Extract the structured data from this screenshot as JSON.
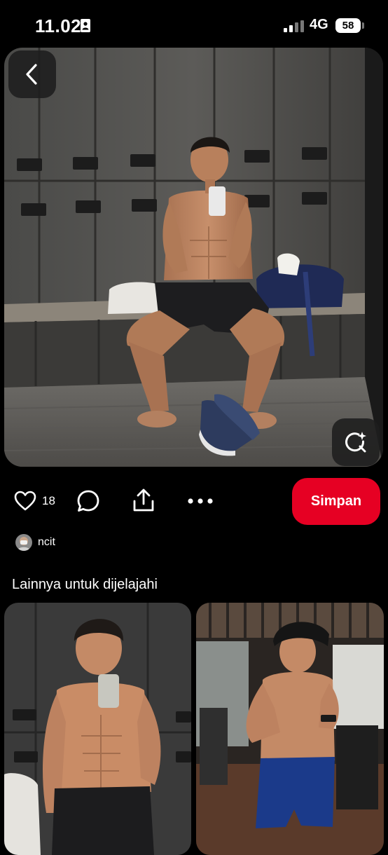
{
  "status_bar": {
    "time": "11.02",
    "network": "4G",
    "battery": "58"
  },
  "pin": {
    "like_count": "18",
    "save_label": "Simpan",
    "creator_name": "ncit"
  },
  "more_ideas": {
    "heading": "Lainnya untuk dijelajahi"
  },
  "icons": {
    "back": "chevron-left-icon",
    "visual_search": "sparkle-search-icon",
    "like": "heart-icon",
    "comment": "comment-bubble-icon",
    "share": "share-icon",
    "more": "ellipsis-icon"
  },
  "colors": {
    "background": "#000000",
    "accent": "#e60023",
    "text": "#ffffff"
  }
}
